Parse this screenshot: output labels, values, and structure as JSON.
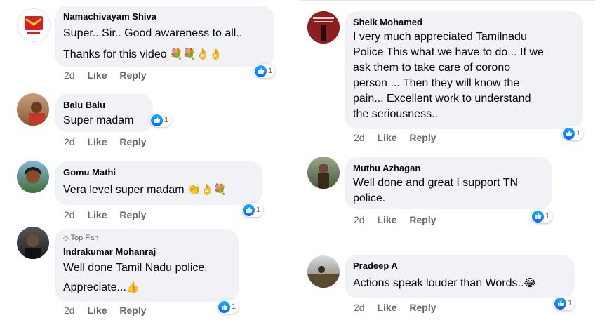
{
  "colors": {
    "bubble": "#f0f2f5",
    "like_blue": "#0866ff",
    "meta": "#65676b"
  },
  "left": [
    {
      "name": "Namachivayam Shiva",
      "lines": [
        "Super.. Sir.. Good awareness to all..",
        "Thanks for this video"
      ],
      "emoji_icons": [
        "bouquet-icon",
        "bouquet-icon",
        "ok-hand-icon",
        "ok-hand-icon"
      ],
      "time": "2d",
      "like": "Like",
      "reply": "Reply",
      "reactions": "1"
    },
    {
      "name": "Balu Balu",
      "lines": [
        "Super madam"
      ],
      "time": "2d",
      "like": "Like",
      "reply": "Reply",
      "reactions": "1"
    },
    {
      "name": "Gomu Mathi",
      "lines": [
        "Vera level super madam"
      ],
      "emoji_icons": [
        "clapping-hands-icon",
        "ok-hand-icon",
        "bouquet-icon"
      ],
      "time": "2d",
      "like": "Like",
      "reply": "Reply",
      "reactions": "1"
    },
    {
      "badge": "Top Fan",
      "name": "Indrakumar Mohanraj",
      "lines": [
        "Well done Tamil Nadu police.",
        "Appreciate..."
      ],
      "emoji_icons": [
        "thumbs-up-icon"
      ],
      "time": "2d",
      "like": "Like",
      "reply": "Reply",
      "reactions": "1"
    }
  ],
  "right": [
    {
      "name": "Sheik Mohamed",
      "lines": [
        "I very much appreciated Tamilnadu",
        "Police  This what we have to do... If we",
        "ask them to take care of corono",
        "person ... Then they will know the",
        "pain... Excellent work to understand",
        "the seriousness.."
      ],
      "time": "2d",
      "like": "Like",
      "reply": "Reply",
      "reactions": "1"
    },
    {
      "name": "Muthu Azhagan",
      "lines": [
        "Well done and great I support TN",
        "police."
      ],
      "time": "2d",
      "like": "Like",
      "reply": "Reply",
      "reactions": "1"
    },
    {
      "name": "Pradeep A",
      "lines": [
        "Actions speak louder than Words.."
      ],
      "emoji_icons": [
        "laughing-tears-icon"
      ],
      "time": "2d",
      "like": "Like",
      "reply": "Reply",
      "reactions": "1"
    }
  ]
}
